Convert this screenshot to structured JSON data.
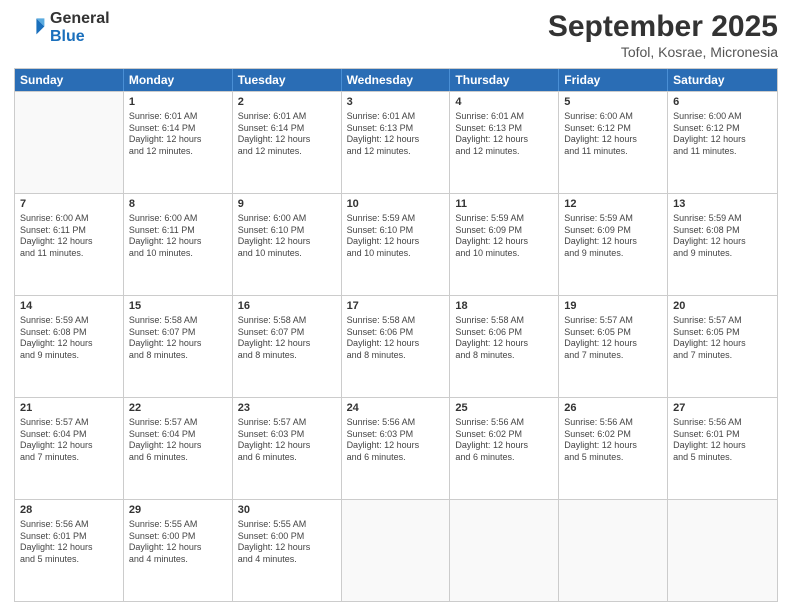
{
  "logo": {
    "line1": "General",
    "line2": "Blue"
  },
  "title": "September 2025",
  "subtitle": "Tofol, Kosrae, Micronesia",
  "days": [
    "Sunday",
    "Monday",
    "Tuesday",
    "Wednesday",
    "Thursday",
    "Friday",
    "Saturday"
  ],
  "weeks": [
    [
      {
        "day": "",
        "data": ""
      },
      {
        "day": "1",
        "data": "Sunrise: 6:01 AM\nSunset: 6:14 PM\nDaylight: 12 hours\nand 12 minutes."
      },
      {
        "day": "2",
        "data": "Sunrise: 6:01 AM\nSunset: 6:14 PM\nDaylight: 12 hours\nand 12 minutes."
      },
      {
        "day": "3",
        "data": "Sunrise: 6:01 AM\nSunset: 6:13 PM\nDaylight: 12 hours\nand 12 minutes."
      },
      {
        "day": "4",
        "data": "Sunrise: 6:01 AM\nSunset: 6:13 PM\nDaylight: 12 hours\nand 12 minutes."
      },
      {
        "day": "5",
        "data": "Sunrise: 6:00 AM\nSunset: 6:12 PM\nDaylight: 12 hours\nand 11 minutes."
      },
      {
        "day": "6",
        "data": "Sunrise: 6:00 AM\nSunset: 6:12 PM\nDaylight: 12 hours\nand 11 minutes."
      }
    ],
    [
      {
        "day": "7",
        "data": "Sunrise: 6:00 AM\nSunset: 6:11 PM\nDaylight: 12 hours\nand 11 minutes."
      },
      {
        "day": "8",
        "data": "Sunrise: 6:00 AM\nSunset: 6:11 PM\nDaylight: 12 hours\nand 10 minutes."
      },
      {
        "day": "9",
        "data": "Sunrise: 6:00 AM\nSunset: 6:10 PM\nDaylight: 12 hours\nand 10 minutes."
      },
      {
        "day": "10",
        "data": "Sunrise: 5:59 AM\nSunset: 6:10 PM\nDaylight: 12 hours\nand 10 minutes."
      },
      {
        "day": "11",
        "data": "Sunrise: 5:59 AM\nSunset: 6:09 PM\nDaylight: 12 hours\nand 10 minutes."
      },
      {
        "day": "12",
        "data": "Sunrise: 5:59 AM\nSunset: 6:09 PM\nDaylight: 12 hours\nand 9 minutes."
      },
      {
        "day": "13",
        "data": "Sunrise: 5:59 AM\nSunset: 6:08 PM\nDaylight: 12 hours\nand 9 minutes."
      }
    ],
    [
      {
        "day": "14",
        "data": "Sunrise: 5:59 AM\nSunset: 6:08 PM\nDaylight: 12 hours\nand 9 minutes."
      },
      {
        "day": "15",
        "data": "Sunrise: 5:58 AM\nSunset: 6:07 PM\nDaylight: 12 hours\nand 8 minutes."
      },
      {
        "day": "16",
        "data": "Sunrise: 5:58 AM\nSunset: 6:07 PM\nDaylight: 12 hours\nand 8 minutes."
      },
      {
        "day": "17",
        "data": "Sunrise: 5:58 AM\nSunset: 6:06 PM\nDaylight: 12 hours\nand 8 minutes."
      },
      {
        "day": "18",
        "data": "Sunrise: 5:58 AM\nSunset: 6:06 PM\nDaylight: 12 hours\nand 8 minutes."
      },
      {
        "day": "19",
        "data": "Sunrise: 5:57 AM\nSunset: 6:05 PM\nDaylight: 12 hours\nand 7 minutes."
      },
      {
        "day": "20",
        "data": "Sunrise: 5:57 AM\nSunset: 6:05 PM\nDaylight: 12 hours\nand 7 minutes."
      }
    ],
    [
      {
        "day": "21",
        "data": "Sunrise: 5:57 AM\nSunset: 6:04 PM\nDaylight: 12 hours\nand 7 minutes."
      },
      {
        "day": "22",
        "data": "Sunrise: 5:57 AM\nSunset: 6:04 PM\nDaylight: 12 hours\nand 6 minutes."
      },
      {
        "day": "23",
        "data": "Sunrise: 5:57 AM\nSunset: 6:03 PM\nDaylight: 12 hours\nand 6 minutes."
      },
      {
        "day": "24",
        "data": "Sunrise: 5:56 AM\nSunset: 6:03 PM\nDaylight: 12 hours\nand 6 minutes."
      },
      {
        "day": "25",
        "data": "Sunrise: 5:56 AM\nSunset: 6:02 PM\nDaylight: 12 hours\nand 6 minutes."
      },
      {
        "day": "26",
        "data": "Sunrise: 5:56 AM\nSunset: 6:02 PM\nDaylight: 12 hours\nand 5 minutes."
      },
      {
        "day": "27",
        "data": "Sunrise: 5:56 AM\nSunset: 6:01 PM\nDaylight: 12 hours\nand 5 minutes."
      }
    ],
    [
      {
        "day": "28",
        "data": "Sunrise: 5:56 AM\nSunset: 6:01 PM\nDaylight: 12 hours\nand 5 minutes."
      },
      {
        "day": "29",
        "data": "Sunrise: 5:55 AM\nSunset: 6:00 PM\nDaylight: 12 hours\nand 4 minutes."
      },
      {
        "day": "30",
        "data": "Sunrise: 5:55 AM\nSunset: 6:00 PM\nDaylight: 12 hours\nand 4 minutes."
      },
      {
        "day": "",
        "data": ""
      },
      {
        "day": "",
        "data": ""
      },
      {
        "day": "",
        "data": ""
      },
      {
        "day": "",
        "data": ""
      }
    ]
  ]
}
